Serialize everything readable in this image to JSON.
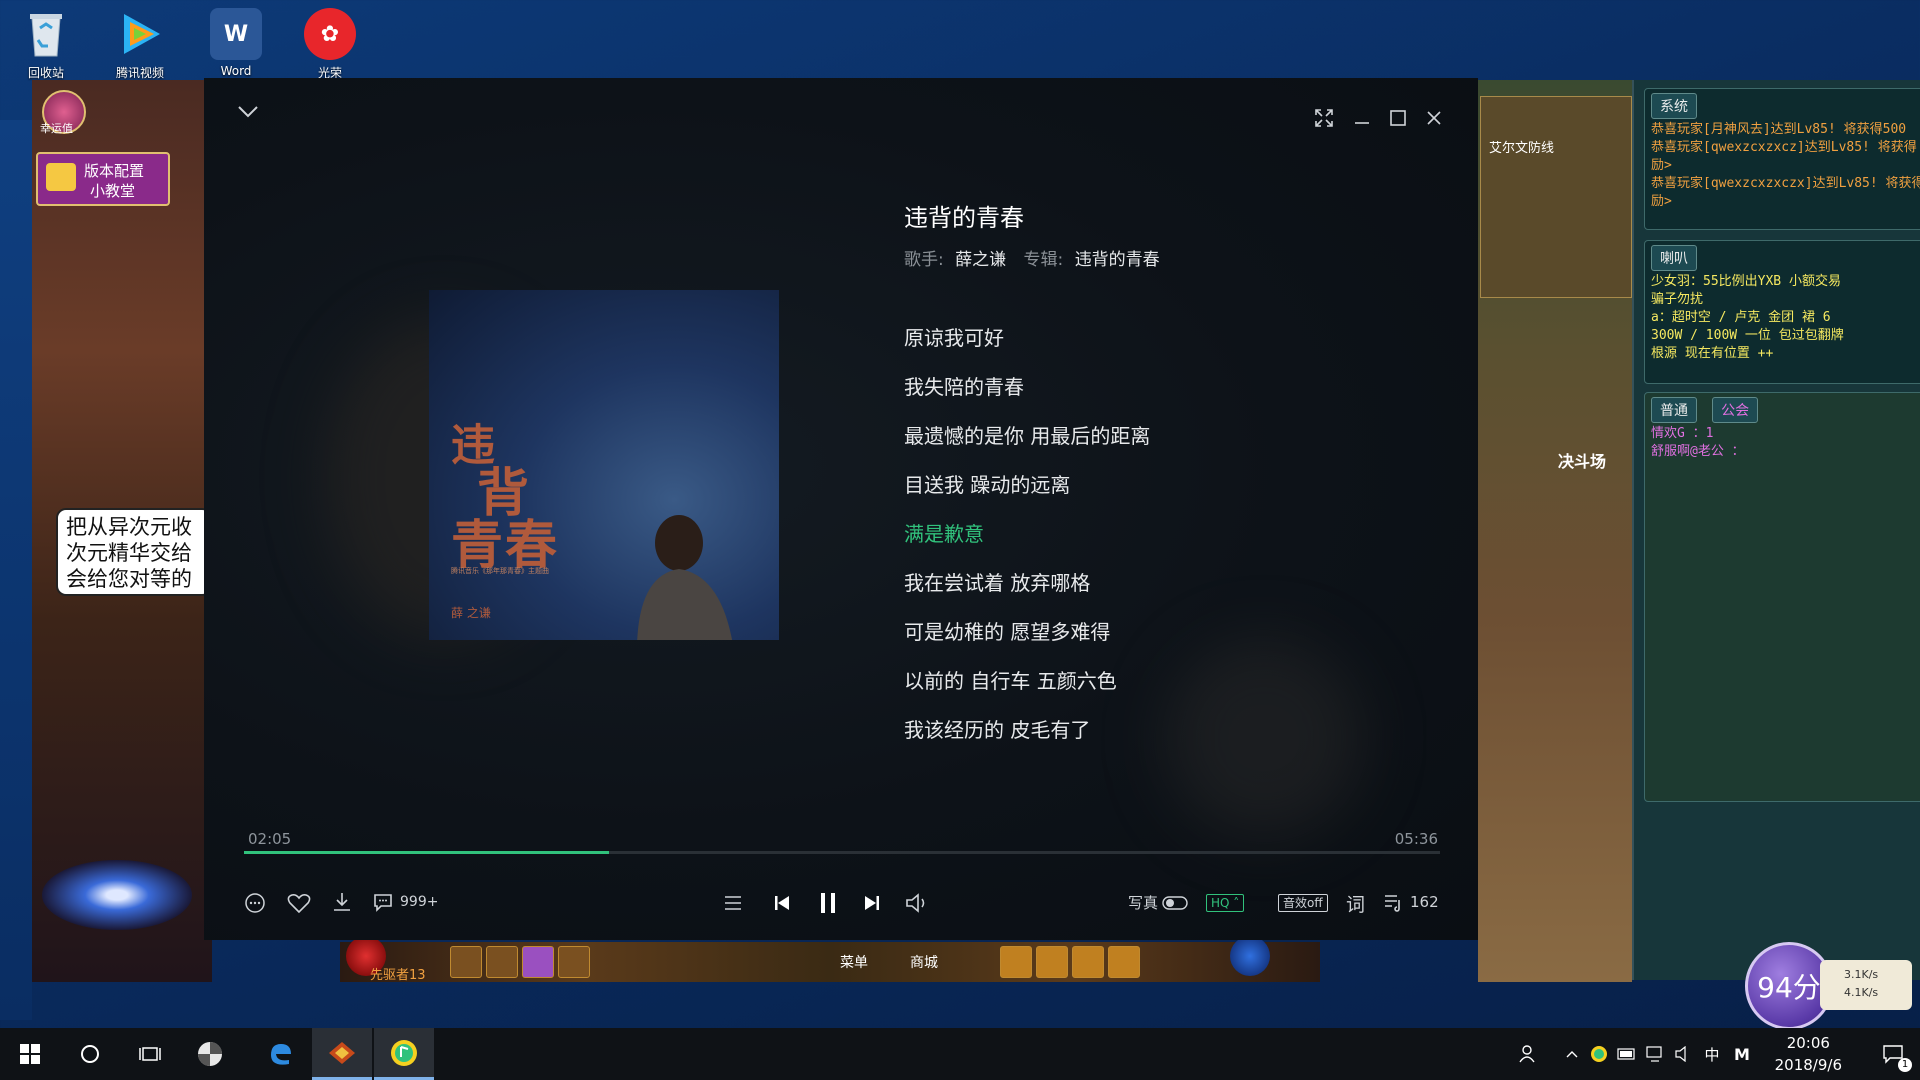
{
  "desktop": {
    "icons": [
      {
        "label": "回收站",
        "icon": "recycle-bin-icon"
      },
      {
        "label": "腾讯视频",
        "icon": "tencent-video-icon"
      },
      {
        "label": "Word",
        "icon": "word-icon"
      },
      {
        "label": "光荣",
        "icon": "app-icon"
      }
    ]
  },
  "game": {
    "badge_top": "幸运值",
    "promo_line1": "版本配置",
    "promo_line2": "小教堂",
    "npc_text_line1": "把从异次元收",
    "npc_text_line2": "次元精华交给",
    "npc_text_line3": "会给您对等的",
    "map_label": "艾尔文防线",
    "arena_label": "决斗场",
    "player_name": "先驱者13",
    "menu_btn": "菜单",
    "shop_btn": "商城",
    "chat": {
      "system_tab": "系统",
      "system_lines": [
        "恭喜玩家[月神风去]达到Lv85! 将获得500",
        "恭喜玩家[qwexzcxzxcz]达到Lv85! 将获得",
        "励>",
        "恭喜玩家[qwexzcxzxczx]达到Lv85! 将获得",
        "励>"
      ],
      "horn_tab": "喇叭",
      "horn_lines": [
        "少女羽：55比例出YXB  小额交易",
        "骗子勿扰",
        "a：超时空 / 卢克 金团 裙 6",
        "300W / 100W 一位 包过包翻牌",
        "根源 现在有位置 ++"
      ],
      "normal_tab": "普通",
      "guild_tab": "公会",
      "normal_lines": [
        "情欢G ：1",
        "舒服啊@老公 ："
      ]
    },
    "score": "94分",
    "upload_speed": "3.1K/s",
    "download_speed": "4.1K/s"
  },
  "player": {
    "song_title": "违背的青春",
    "singer_label": "歌手:",
    "singer": "薛之谦",
    "album_label": "专辑:",
    "album": "违背的青春",
    "album_art_title": "违背的青春",
    "album_art_subtitle": "腾讯音乐《那年那青春》主题曲",
    "album_art_artist": "薛 之谦",
    "lyrics": [
      "原谅我可好",
      "我失陪的青春",
      "最遗憾的是你 用最后的距离",
      "目送我 躁动的远离",
      "满是歉意",
      "我在尝试着 放弃哪格",
      "可是幼稚的 愿望多难得",
      "以前的 自行车 五颜六色",
      "我该经历的 皮毛有了"
    ],
    "active_lyric_index": 4,
    "time_current": "02:05",
    "time_total": "05:36",
    "progress_fraction": 0.305,
    "comment_count": "999+",
    "photo_label": "写真",
    "quality_label": "HQ",
    "effect_label": "音效off",
    "lyric_btn": "词",
    "playlist_count": "162",
    "accent_color": "#31c27c"
  },
  "taskbar": {
    "time": "20:06",
    "date": "2018/9/6",
    "ime": "中",
    "ime_mode": "M",
    "notification_count": "1"
  }
}
